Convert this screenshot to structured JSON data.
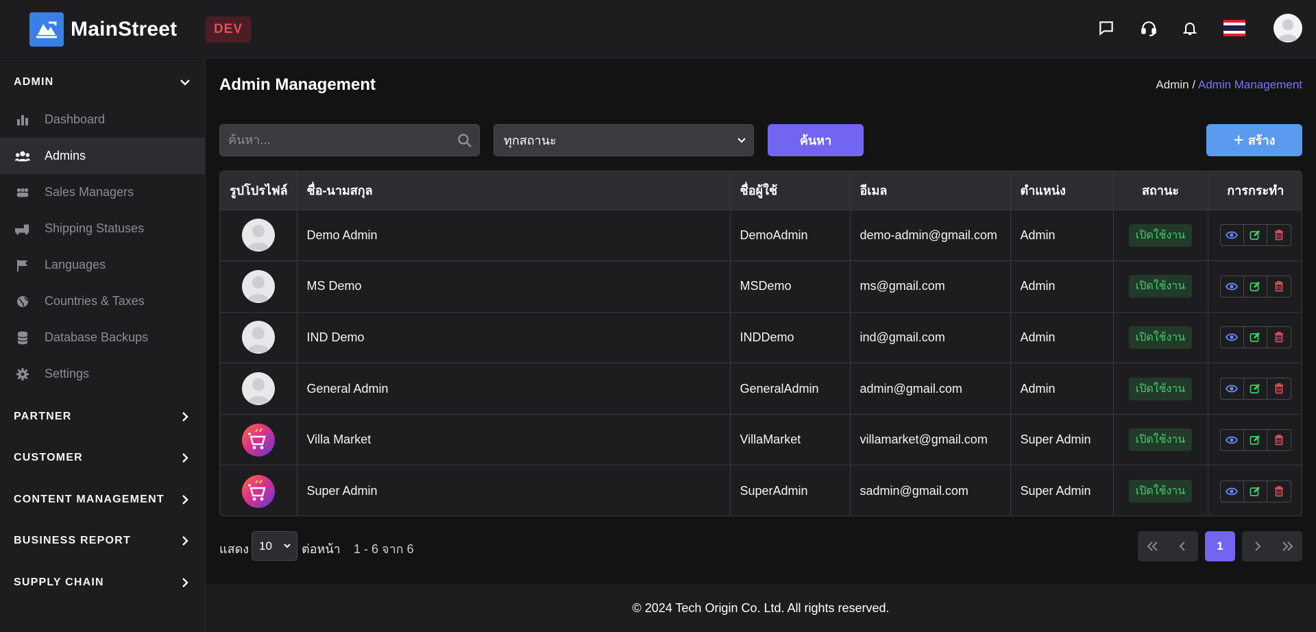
{
  "brand": {
    "name": "MainStreet",
    "env": "DEV"
  },
  "header_icons": [
    "chat-icon",
    "headset-icon",
    "bell-icon",
    "thai-flag-icon",
    "user-avatar"
  ],
  "sidebar": {
    "admin_section": "ADMIN",
    "items": [
      {
        "label": "Dashboard",
        "icon": "bar-chart-icon"
      },
      {
        "label": "Admins",
        "icon": "users-icon",
        "active": true
      },
      {
        "label": "Sales Managers",
        "icon": "group-icon"
      },
      {
        "label": "Shipping Statuses",
        "icon": "truck-icon"
      },
      {
        "label": "Languages",
        "icon": "flag-icon"
      },
      {
        "label": "Countries & Taxes",
        "icon": "globe-icon"
      },
      {
        "label": "Database Backups",
        "icon": "database-icon"
      },
      {
        "label": "Settings",
        "icon": "gear-icon"
      }
    ],
    "sections": [
      "PARTNER",
      "CUSTOMER",
      "CONTENT MANAGEMENT",
      "BUSINESS REPORT",
      "SUPPLY CHAIN"
    ]
  },
  "page": {
    "title": "Admin Management",
    "breadcrumb_root": "Admin",
    "breadcrumb_sep": "/",
    "breadcrumb_current": "Admin Management"
  },
  "filters": {
    "search_placeholder": "ค้นหา...",
    "status_value": "ทุกสถานะ",
    "search_button": "ค้นหา",
    "create_button": "สร้าง"
  },
  "table": {
    "headers": [
      "รูปโปรไฟล์",
      "ชื่อ-นามสกุล",
      "ชื่อผู้ใช้",
      "อีเมล",
      "ตำแหน่ง",
      "สถานะ",
      "การกระทำ"
    ],
    "rows": [
      {
        "avatar": "default",
        "name": "Demo Admin",
        "username": "DemoAdmin",
        "email": "demo-admin@gmail.com",
        "role": "Admin",
        "status": "เปิดใช้งาน"
      },
      {
        "avatar": "default",
        "name": "MS Demo",
        "username": "MSDemo",
        "email": "ms@gmail.com",
        "role": "Admin",
        "status": "เปิดใช้งาน"
      },
      {
        "avatar": "default",
        "name": "IND Demo",
        "username": "INDDemo",
        "email": "ind@gmail.com",
        "role": "Admin",
        "status": "เปิดใช้งาน"
      },
      {
        "avatar": "default",
        "name": "General Admin",
        "username": "GeneralAdmin",
        "email": "admin@gmail.com",
        "role": "Admin",
        "status": "เปิดใช้งาน"
      },
      {
        "avatar": "logo",
        "name": "Villa Market",
        "username": "VillaMarket",
        "email": "villamarket@gmail.com",
        "role": "Super Admin",
        "status": "เปิดใช้งาน"
      },
      {
        "avatar": "logo",
        "name": "Super Admin",
        "username": "SuperAdmin",
        "email": "sadmin@gmail.com",
        "role": "Super Admin",
        "status": "เปิดใช้งาน"
      }
    ]
  },
  "pagination": {
    "show_label": "แสดง",
    "per_page": "10",
    "per_page_suffix": "ต่อหน้า",
    "range_text": "1 - 6 จาก 6",
    "current_page": "1"
  },
  "footer": {
    "text": "© 2024 Tech Origin Co. Ltd. All rights reserved."
  },
  "colors": {
    "accent": "#7266f0",
    "create": "#5a9bf0",
    "status_green": "#3fcf6a",
    "danger": "#e0505c"
  }
}
